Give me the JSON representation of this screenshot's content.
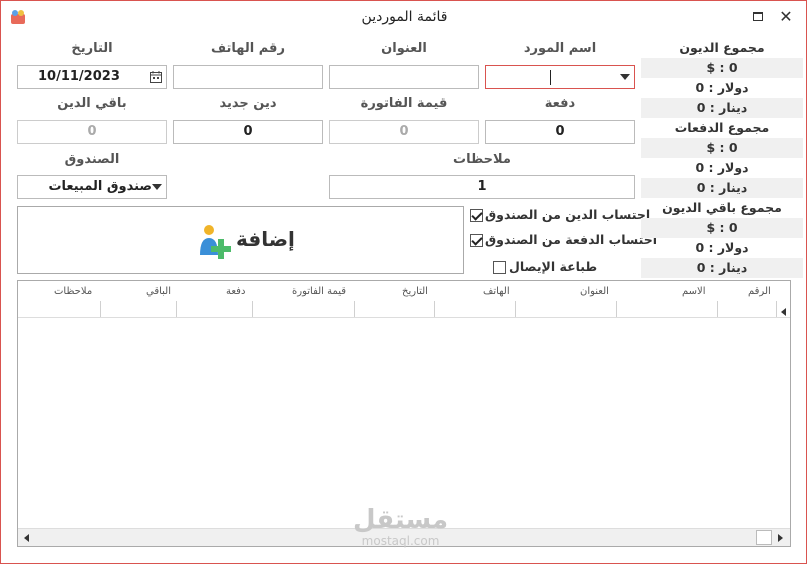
{
  "window": {
    "title": "قائمة الموردين"
  },
  "labels": {
    "supplier_name": "اسم المورد",
    "address": "العنوان",
    "phone": "رقم الهاتف",
    "date": "التاريخ",
    "payment": "دفعة",
    "invoice_value": "قيمة الفاتورة",
    "new_debt": "دين جديد",
    "remaining_debt": "باقي الدين",
    "notes": "ملاحظات",
    "cashbox": "الصندوق"
  },
  "fields": {
    "supplier_name": "",
    "address": "",
    "phone": "",
    "date": "10/11/2023",
    "payment": "0",
    "invoice_value": "0",
    "new_debt": "0",
    "remaining_debt": "0",
    "notes": "1",
    "cashbox": "صندوق المبيعات"
  },
  "summary": {
    "debts_title": "مجموع الديون",
    "debts_usd_sym": "$ : 0",
    "debts_dollar": "دولار : 0",
    "debts_dinar": "دينار : 0",
    "payments_title": "مجموع الدفعات",
    "payments_usd_sym": "$ : 0",
    "payments_dollar": "دولار : 0",
    "payments_dinar": "دينار : 0",
    "remaining_title": "مجموع باقي الديون",
    "remaining_usd_sym": "$ : 0",
    "remaining_dollar": "دولار : 0",
    "remaining_dinar": "دينار : 0"
  },
  "options": {
    "debt_from_cashbox": "احتساب الدين من الصندوق",
    "payment_from_cashbox": "احتساب الدفعة من الصندوق",
    "print_receipt": "طباعة الإيصال"
  },
  "option_states": {
    "debt_from_cashbox": true,
    "payment_from_cashbox": true,
    "print_receipt": false
  },
  "add_button": {
    "label": "إضافة"
  },
  "table": {
    "columns": [
      "الرقم",
      "الاسم",
      "العنوان",
      "الهاتف",
      "التاريخ",
      "قيمة الفاتورة",
      "دفعة",
      "الباقي",
      "ملاحظات"
    ]
  },
  "watermark": {
    "arabic": "مستقل",
    "latin": "mostaql.com"
  },
  "colors": {
    "accent_border": "#d9534f",
    "add_icon_person": "#3a8fd8",
    "add_icon_plus": "#4cbb6a",
    "add_icon_head": "#f0b429"
  }
}
